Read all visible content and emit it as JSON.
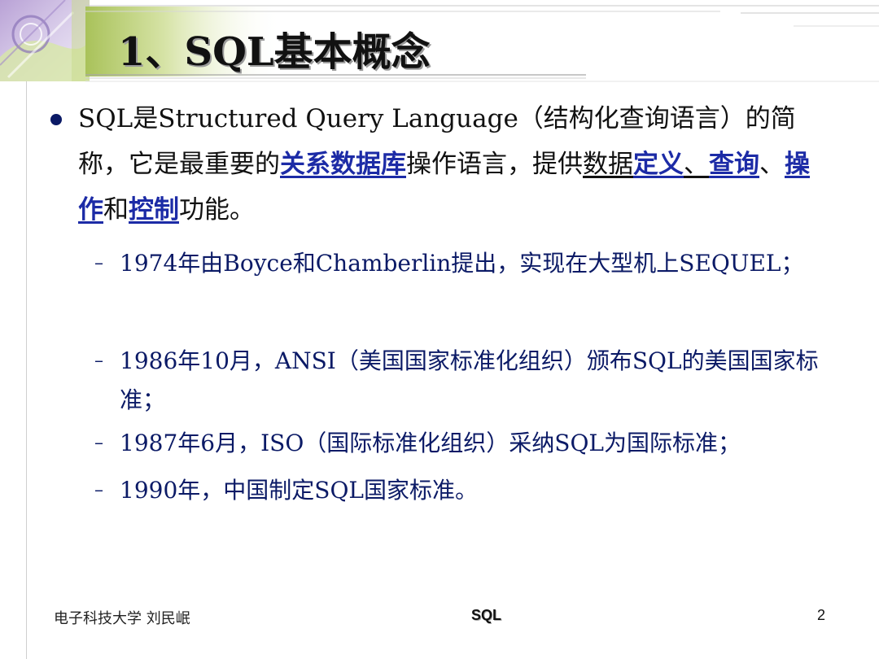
{
  "title": "1、SQL基本概念",
  "intro": {
    "p1": "SQL是Structured Query Language（结构化查询语言）的简称，它是最重要的",
    "link_rdb": "关系数据库",
    "p2": "操作语言，提供",
    "data_word": "数据",
    "link_define": "定义",
    "sep1": "、",
    "link_query": "查询",
    "sep2": "、",
    "link_operate": "操作",
    "and_word": "和",
    "link_control": "控制",
    "p3": "功能。"
  },
  "sub_items": [
    "1974年由Boyce和Chamberlin提出，实现在大型机上SEQUEL；",
    "1986年10月，ANSI（美国国家标准化组织）颁布SQL的美国国家标准；",
    "1987年6月，ISO（国际标准化组织）采纳SQL为国际标准；",
    "1990年，中国制定SQL国家标准。"
  ],
  "dash": "–",
  "footer": {
    "author": "电子科技大学 刘民岷",
    "topic": "SQL",
    "page": "2"
  }
}
